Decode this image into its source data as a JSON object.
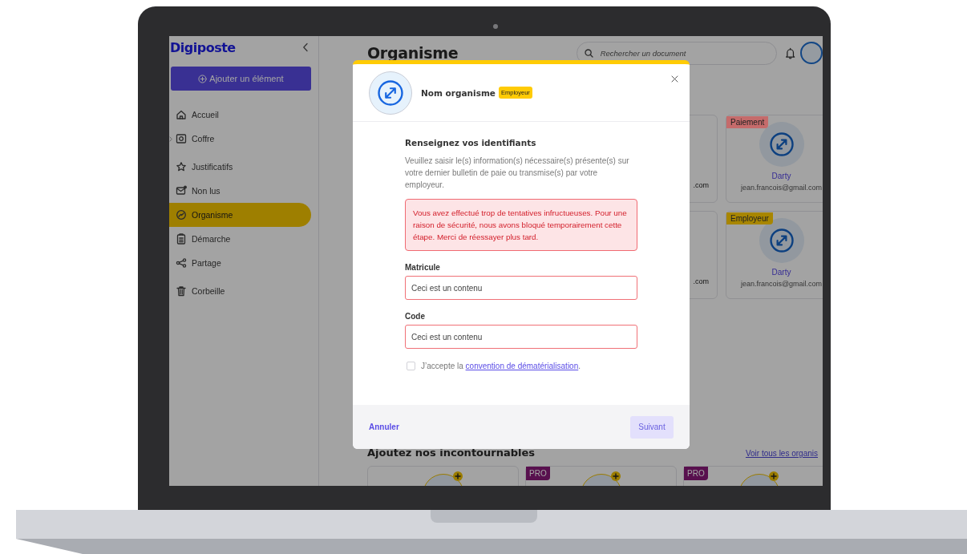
{
  "sidebar": {
    "logo": "Digiposte",
    "add_button": "Ajouter un élément",
    "items": [
      {
        "label": "Accueil",
        "selected": false,
        "collapsible": false
      },
      {
        "label": "Coffre",
        "selected": false,
        "collapsible": true
      },
      {
        "label": "Justificatifs",
        "selected": false,
        "collapsible": false
      },
      {
        "label": "Non lus",
        "selected": false,
        "collapsible": false
      },
      {
        "label": "Organisme",
        "selected": true,
        "collapsible": false
      },
      {
        "label": "Démarche",
        "selected": false,
        "collapsible": false
      },
      {
        "label": "Partage",
        "selected": false,
        "collapsible": false
      },
      {
        "label": "Corbeille",
        "selected": false,
        "collapsible": false
      }
    ]
  },
  "header": {
    "title": "Organisme",
    "search": {
      "placeholder": "Rechercher un document"
    }
  },
  "organisms": [
    {
      "email": ".com"
    },
    {
      "tag": "Paiement",
      "color": "#c56b6b",
      "name": "Darty",
      "email": "jean.francois@gmail.com"
    },
    {
      "email": ".com"
    },
    {
      "tag": "Employeur",
      "color": "#a88600",
      "name": "Darty",
      "email": "jean.francois@gmail.com"
    }
  ],
  "suggestions": {
    "title": "Ajoutez nos incontournables",
    "link": "Voir tous les organis",
    "items": [
      {
        "added": false
      },
      {
        "badge": "PRO",
        "added": false
      },
      {
        "badge": "PRO",
        "added": false
      }
    ]
  },
  "modal": {
    "org_name": "Nom organisme",
    "tag": "Employeur",
    "heading": "Renseignez vos identifiants",
    "description": "Veuillez saisir le(s) information(s) nécessaire(s) présente(s) sur votre dernier bulletin de paie ou transmise(s) par votre employeur.",
    "error": "Vous avez effectué trop de tentatives infructueuses. Pour une raison de sécurité, nous avons bloqué temporairement cette étape. Merci de réessayer plus tard.",
    "fields": [
      {
        "label": "Matricule",
        "value": "Ceci est un contenu",
        "invalid": true
      },
      {
        "label": "Code",
        "value": "Ceci est un contenu",
        "invalid": true
      }
    ],
    "consent": {
      "checked": false,
      "text": "J’accepte la ",
      "link": "convention de dématérialisation",
      "end": "."
    },
    "cancel": "Annuler",
    "next": {
      "label": "Suivant",
      "disabled": true
    }
  }
}
